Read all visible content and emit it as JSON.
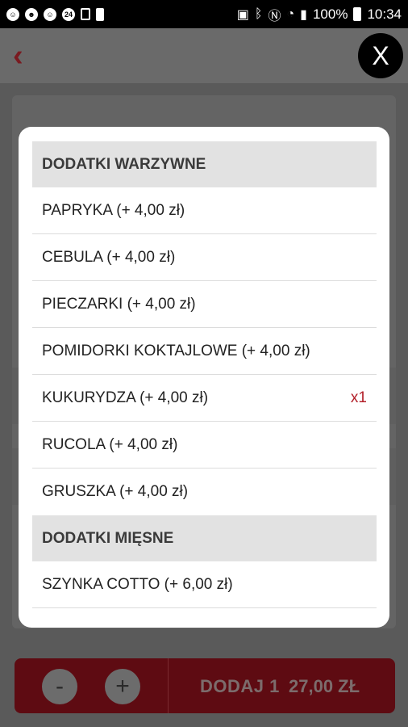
{
  "status_bar": {
    "battery": "100%",
    "time": "10:34",
    "icons_left": [
      "smile-icon",
      "smile-icon",
      "smile-icon",
      "24-icon",
      "checklist-icon",
      "battery-small-icon"
    ],
    "icons_right": [
      "lock-icon",
      "bluetooth-icon",
      "nfc-icon",
      "wifi-icon",
      "signal-icon"
    ]
  },
  "app": {
    "back_icon": "chevron-left-icon",
    "close_label": "X"
  },
  "bottom_bar": {
    "minus_label": "-",
    "plus_label": "+",
    "add_label": "DODAJ 1",
    "price": "27,00 ZŁ"
  },
  "modal": {
    "sections": [
      {
        "title": "DODATKI WARZYWNE",
        "items": [
          {
            "label": "PAPRYKA (+ 4,00 zł)",
            "count": ""
          },
          {
            "label": "CEBULA (+ 4,00 zł)",
            "count": ""
          },
          {
            "label": "PIECZARKI (+ 4,00 zł)",
            "count": ""
          },
          {
            "label": "POMIDORKI KOKTAJLOWE (+ 4,00 zł)",
            "count": ""
          },
          {
            "label": "KUKURYDZA (+ 4,00 zł)",
            "count": "x1"
          },
          {
            "label": "RUCOLA (+ 4,00 zł)",
            "count": ""
          },
          {
            "label": "GRUSZKA (+ 4,00 zł)",
            "count": ""
          }
        ]
      },
      {
        "title": "DODATKI MIĘSNE",
        "items": [
          {
            "label": "SZYNKA COTTO (+ 6,00 zł)",
            "count": ""
          }
        ]
      }
    ]
  },
  "colors": {
    "accent": "#b3202a",
    "bottom_bar": "#5e0b12",
    "section_header_bg": "#e2e2e2"
  }
}
